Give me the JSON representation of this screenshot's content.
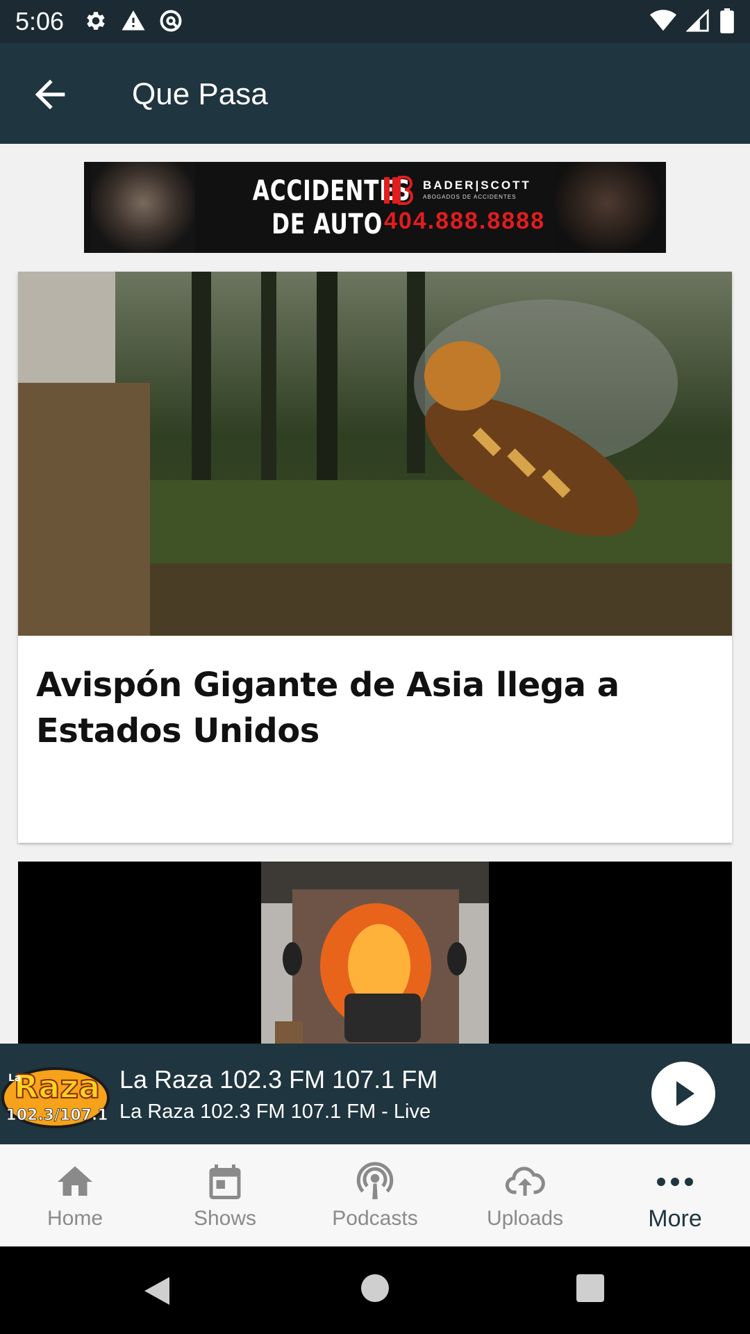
{
  "status_bar": {
    "time": "5:06",
    "left_icons": [
      "gear-icon",
      "warning-icon",
      "at-sync-icon"
    ],
    "right_icons": [
      "wifi-icon",
      "signal-icon",
      "battery-icon"
    ]
  },
  "app_bar": {
    "title": "Que Pasa",
    "back_icon": "arrow-left-icon"
  },
  "ad": {
    "headline": "ACCIDENTES DE AUTO",
    "brand": "BADER|SCOTT",
    "brand_sub": "ABOGADOS DE ACCIDENTES",
    "phone": "404.888.8888"
  },
  "articles": [
    {
      "title": "Avispón Gigante de Asia llega a Estados Unidos"
    }
  ],
  "now_playing": {
    "logo_text": "La Raza 102.3/107.1",
    "title": "La Raza 102.3 FM 107.1 FM",
    "subtitle": "La Raza 102.3 FM 107.1 FM - Live",
    "play_icon": "play-icon"
  },
  "bottom_nav": {
    "items": [
      {
        "label": "Home",
        "icon": "home-icon"
      },
      {
        "label": "Shows",
        "icon": "calendar-icon"
      },
      {
        "label": "Podcasts",
        "icon": "podcast-icon"
      },
      {
        "label": "Uploads",
        "icon": "cloud-upload-icon"
      },
      {
        "label": "More",
        "icon": "more-dots-icon",
        "active": true
      }
    ]
  },
  "colors": {
    "status_bar": "#1b2a33",
    "app_bar": "#1f3540",
    "accent": "#1f3540",
    "nav_inactive": "#8a8a8a"
  }
}
